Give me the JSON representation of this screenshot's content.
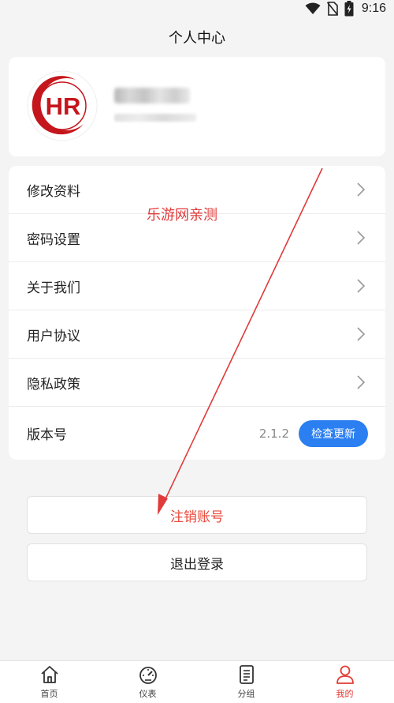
{
  "status_bar": {
    "time": "9:16"
  },
  "header": {
    "title": "个人中心"
  },
  "profile": {
    "logo_text": "HR"
  },
  "menu": {
    "items": [
      {
        "label": "修改资料"
      },
      {
        "label": "密码设置"
      },
      {
        "label": "关于我们"
      },
      {
        "label": "用户协议"
      },
      {
        "label": "隐私政策"
      }
    ],
    "version": {
      "label": "版本号",
      "value": "2.1.2",
      "button": "检查更新"
    }
  },
  "actions": {
    "delete_account": "注销账号",
    "logout": "退出登录"
  },
  "watermark": {
    "text": "乐游网亲测"
  },
  "tabbar": {
    "items": [
      {
        "label": "首页",
        "icon": "home-icon"
      },
      {
        "label": "仪表",
        "icon": "gauge-icon"
      },
      {
        "label": "分组",
        "icon": "document-icon"
      },
      {
        "label": "我的",
        "icon": "person-icon",
        "active": true
      }
    ]
  },
  "colors": {
    "accent": "#2b7ff1",
    "danger": "#e8473a",
    "active_tab": "#e23b33",
    "background": "#f4f4f4"
  }
}
